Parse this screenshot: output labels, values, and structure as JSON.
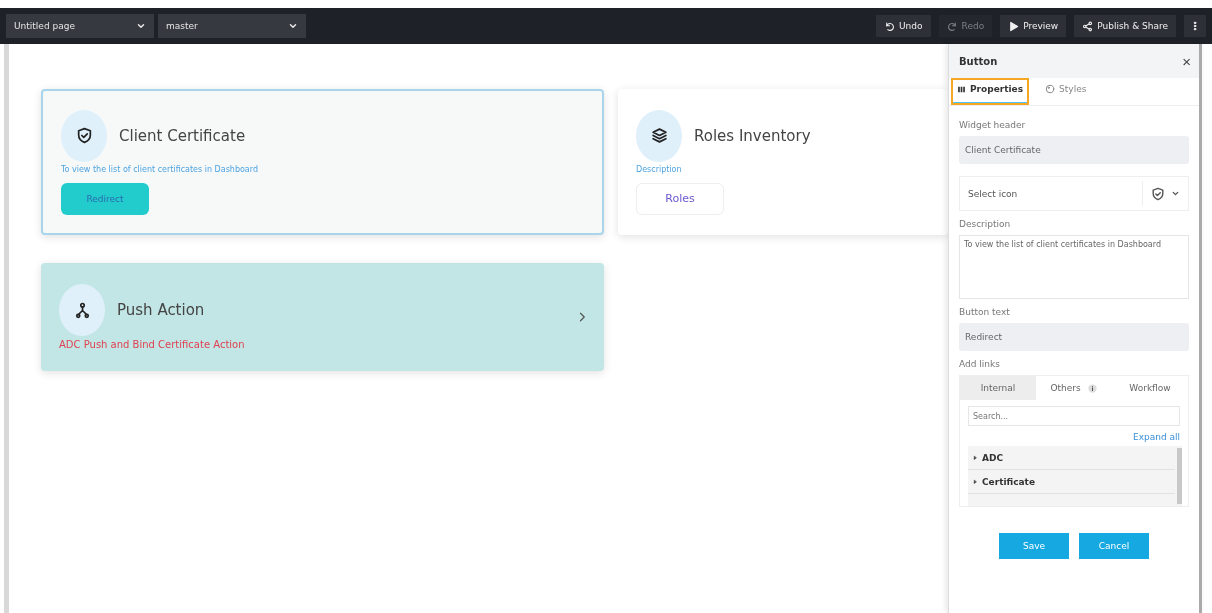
{
  "top_bar": {
    "page_select": "Untitled page",
    "branch_select": "master",
    "actions": [
      {
        "label": "Undo",
        "disabled": false
      },
      {
        "label": "Redo",
        "disabled": true
      },
      {
        "label": "Preview",
        "disabled": false
      },
      {
        "label": "Publish & Share",
        "disabled": false
      }
    ]
  },
  "widgets": [
    {
      "kind": "button",
      "title": "Client Certificate",
      "description": "To view the list of client certificates in Dashboard",
      "button": "Redirect",
      "selected": true
    },
    {
      "kind": "outline",
      "title": "Roles Inventory",
      "description": "Description",
      "button": "Roles",
      "selected": false
    },
    {
      "kind": "action",
      "title": "Push Action",
      "description": "ADC Push and Bind Certificate Action",
      "selected": false
    }
  ],
  "panel": {
    "title": "Button",
    "close": "×",
    "tabs": [
      {
        "label": "Properties",
        "selected": true
      },
      {
        "label": "Styles",
        "selected": false
      }
    ],
    "widget_header_label": "Widget header",
    "widget_header": "Client Certificate",
    "select_icon": "Select icon",
    "description_label": "Description",
    "description": "To view the list of client certificates in Dashboard",
    "button_text_label": "Button text",
    "button_text": "Redirect",
    "links_label": "Add links",
    "link_tabs": [
      {
        "label": "Internal",
        "selected": true,
        "info": false
      },
      {
        "label": "Others",
        "selected": false,
        "info": true
      },
      {
        "label": "Workflow",
        "selected": false,
        "info": false
      }
    ],
    "search": {
      "placeholder": "Search..."
    },
    "expand_all": "Expand all",
    "tree": [
      {
        "label": "ADC",
        "expanded": false
      },
      {
        "label": "Certificate",
        "expanded": false
      }
    ],
    "buttons": [
      "Save",
      "Cancel"
    ]
  }
}
